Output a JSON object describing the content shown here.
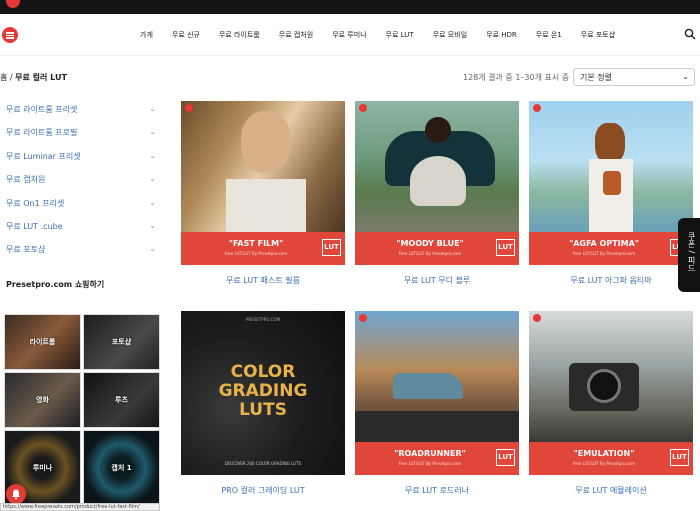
{
  "nav": {
    "links": [
      "가게",
      "무료 신규",
      "무료 라이트룸",
      "무료 캡처원",
      "무료 루미나",
      "무료 LUT",
      "무료 모바일",
      "무료 HDR",
      "무료 온1",
      "무료 포토샵"
    ]
  },
  "breadcrumb": {
    "home": "홈",
    "separator": "/",
    "current": "무료 컬러 LUT"
  },
  "results": {
    "text": "128개 결과 중 1–30개 표시 중"
  },
  "sort": {
    "selected": "기본 정렬"
  },
  "sidebar": {
    "items": [
      {
        "label": "무료 라이트룸 프리셋"
      },
      {
        "label": "무료 라이트룸 프로필"
      },
      {
        "label": "무료 Luminar 프리셋"
      },
      {
        "label": "무료 캡처원"
      },
      {
        "label": "무료 On1 프리셋"
      },
      {
        "label": "무료 LUT .cube"
      },
      {
        "label": "무료 포토샵"
      }
    ],
    "shop_title": "Presetpro.com 쇼핑하기",
    "tiles": [
      {
        "label": "라이트룸"
      },
      {
        "label": "포토샵"
      },
      {
        "label": "영화"
      },
      {
        "label": "루츠"
      },
      {
        "label": "루미나"
      },
      {
        "label": "캡처 1"
      }
    ]
  },
  "products": [
    {
      "name": "\"FAST FILM\"",
      "sub": "Free LUT/LUT By Presetpro.com",
      "lut": "LUT",
      "title": "무료 LUT 패스트 필름"
    },
    {
      "name": "\"MOODY BLUE\"",
      "sub": "Free LUT/LUT By Presetpro.com",
      "lut": "LUT",
      "title": "무료 LUT 무디 블루"
    },
    {
      "name": "\"AGFA OPTIMA\"",
      "sub": "Free LUT/LUT By Presetpro.com",
      "lut": "LUT",
      "title": "무료 LUT 아그파 옵티마"
    },
    {
      "name": "COLOR GRADING LUTS",
      "sub": "PRESETPRO.COM",
      "lut": "",
      "title": "PRO 컬러 그레이딩 LUT",
      "overlay_top": "COLOR",
      "overlay_mid": "GRADING",
      "overlay_bot": "LUTS",
      "caption": "DISCOVER 200 COLOR GRADING LUTS"
    },
    {
      "name": "\"ROADRUNNER\"",
      "sub": "Free LUT/LUT By Presetpro.com",
      "lut": "LUT",
      "title": "무료 LUT 로드러너"
    },
    {
      "name": "\"EMULATION\"",
      "sub": "Free LUT/LUT By Presetpro.com",
      "lut": "LUT",
      "title": "무료 LUT 에뮬레이션"
    }
  ],
  "feedback": {
    "label": "쿠폰 / 피드"
  },
  "statusbar": {
    "url": "https://www.freepresets.com/product/free-lut-fast-film/"
  },
  "colors": {
    "accent": "#e53935",
    "band": "#e0463a",
    "link": "#3b6fb6"
  }
}
